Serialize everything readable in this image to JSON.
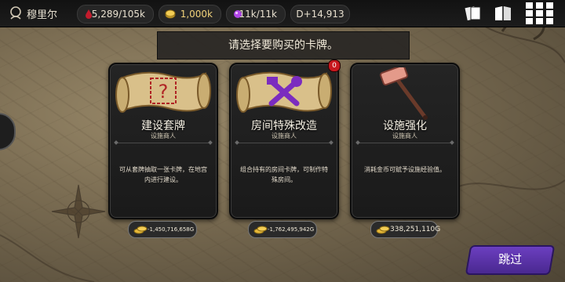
{
  "topbar": {
    "player_name": "穆里尔",
    "health": "5,289/105k",
    "gold": "1,000k",
    "mana": "11k/11k",
    "day": "D+14,913",
    "icons": [
      "player-head-icon",
      "blood-drop-icon",
      "gold-coin-icon",
      "mana-orb-icon",
      "cards-icon",
      "book-icon",
      "grid-menu-icon"
    ]
  },
  "banner": {
    "text": "请选择要购买的卡牌。"
  },
  "cards": [
    {
      "title": "建设套牌",
      "subtitle": "设施商人",
      "description": "可从套牌抽取一张卡牌，在地宫内进行建设。",
      "price": "-1,450,716,658G",
      "art": "scroll-question-icon"
    },
    {
      "title": "房间特殊改造",
      "subtitle": "设施商人",
      "description": "组合持有的房间卡牌，可制作特殊房间。",
      "price": "-1,762,495,942G",
      "badge": "0",
      "art": "scroll-tools-icon"
    },
    {
      "title": "设施强化",
      "subtitle": "设施商人",
      "description": "消耗金币可赋予设施经验值。",
      "price": "338,251,110G",
      "art": "hammer-icon"
    }
  ],
  "skip_button": {
    "label": "跳过"
  },
  "colors": {
    "accent_purple": "#5a33a8",
    "badge_red": "#c8181f",
    "gold": "#e7b93a"
  }
}
